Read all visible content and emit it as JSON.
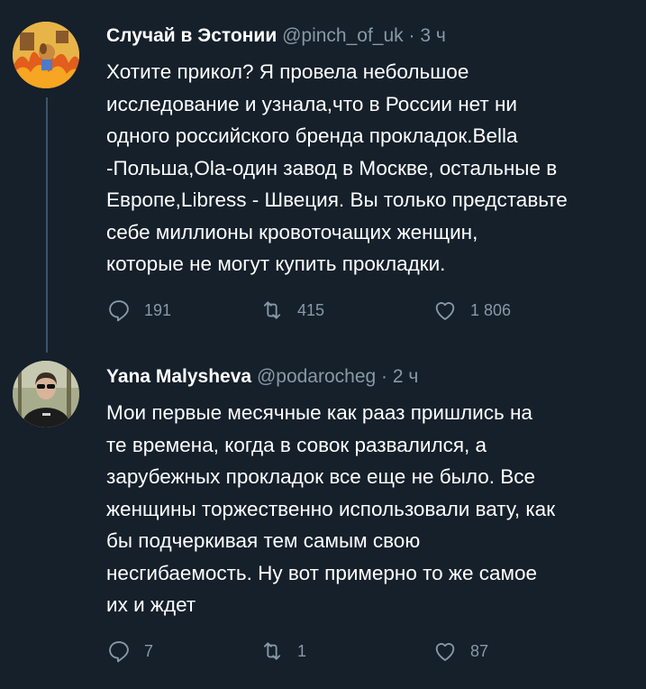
{
  "tweets": [
    {
      "name": "Случай в Эстонии",
      "handle": "@pinch_of_uk",
      "dot": "·",
      "time": "3 ч",
      "lines": [
        "Хотите прикол? Я провела небольшое",
        "исследование и узнала,что в России нет ни",
        "одного российского бренда прокладок.Bella",
        "-Польша,Ola-один завод в Москве, остальные в",
        "Европе,Libress - Швеция. Вы только представьте",
        "себе миллионы кровоточащих женщин,",
        "которые не могут купить прокладки."
      ],
      "replies": "191",
      "retweets": "415",
      "likes": "1 806"
    },
    {
      "name": "Yana Malysheva",
      "handle": "@podarocheg",
      "dot": "·",
      "time": "2 ч",
      "lines": [
        "Мои первые месячные как рааз пришлись на",
        "те времена, когда в совок развалился, а",
        "зарубежных прокладок все еще не было. Все",
        "женщины торжественно использовали вату, как",
        "бы подчеркивая тем самым свою",
        "несгибаемость. Ну вот примерно то же самое",
        "их и ждет"
      ],
      "replies": "7",
      "retweets": "1",
      "likes": "87"
    }
  ],
  "colors": {
    "background": "#15202b",
    "secondary_text": "#8899a6",
    "thread_line": "#3d5466"
  },
  "icons": [
    "reply-icon",
    "retweet-icon",
    "like-icon"
  ]
}
